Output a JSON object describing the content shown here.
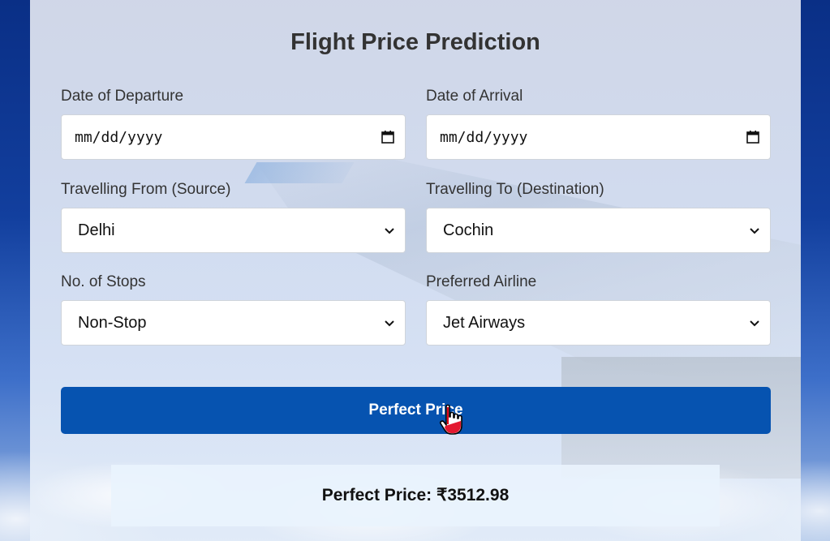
{
  "page": {
    "title": "Flight Price Prediction"
  },
  "form": {
    "departure": {
      "label": "Date of Departure",
      "placeholder": "mm/dd/yyyy",
      "icon": "calendar-icon"
    },
    "arrival": {
      "label": "Date of Arrival",
      "placeholder": "mm/dd/yyyy",
      "icon": "calendar-icon"
    },
    "source": {
      "label": "Travelling From (Source)",
      "value": "Delhi",
      "icon": "chevron-down-icon"
    },
    "destination": {
      "label": "Travelling To (Destination)",
      "value": "Cochin",
      "icon": "chevron-down-icon"
    },
    "stops": {
      "label": "No. of Stops",
      "value": "Non-Stop",
      "icon": "chevron-down-icon"
    },
    "airline": {
      "label": "Preferred Airline",
      "value": "Jet Airways",
      "icon": "chevron-down-icon"
    }
  },
  "submit": {
    "label": "Perfect Price"
  },
  "result": {
    "text": "Perfect Price: ₹3512.98"
  },
  "colors": {
    "button": "#0653b0",
    "title": "#333333"
  }
}
